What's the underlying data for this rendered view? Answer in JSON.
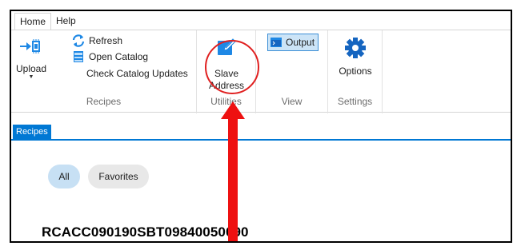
{
  "menu": {
    "tabs": [
      "Home",
      "Help"
    ]
  },
  "ribbon": {
    "upload": {
      "label": "Upload"
    },
    "recipes_group": {
      "refresh": "Refresh",
      "open_catalog": "Open Catalog",
      "check_updates": "Check Catalog Updates",
      "label": "Recipes"
    },
    "utilities_group": {
      "slave_address": "Slave Address",
      "label": "Utilities"
    },
    "view_group": {
      "output": "Output",
      "label": "View"
    },
    "settings_group": {
      "options": "Options",
      "label": "Settings"
    }
  },
  "content": {
    "tab": "Recipes",
    "filters": [
      "All",
      "Favorites"
    ],
    "recipe_name": "RCACC090190SBT09840050090"
  },
  "colors": {
    "accent": "#0078d4",
    "highlight": "#e02020",
    "selected_pill": "#c7e0f4"
  },
  "icons": [
    "upload-icon",
    "refresh-icon",
    "catalog-icon",
    "edit-icon",
    "output-icon",
    "gear-icon"
  ]
}
